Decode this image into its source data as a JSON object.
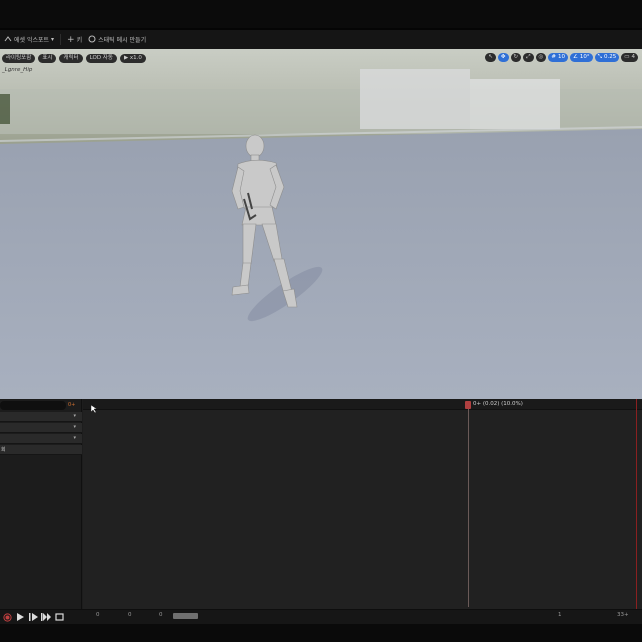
{
  "toolbar": {
    "export_label": "에셋 익스포트",
    "add_label": "키",
    "static_mesh_label": "스태틱 메시 만들기"
  },
  "viewport": {
    "pills": [
      "라이팅포함",
      "표시",
      "캐릭터",
      "LOD 자동",
      "x1.0"
    ],
    "asset_name": "_Lgnre_Hip",
    "right_controls": [
      "10",
      "10°",
      "0.25",
      "4"
    ]
  },
  "left_panel": {
    "plus_label": "0+",
    "tracks": [
      {
        "label": ""
      },
      {
        "label": ""
      },
      {
        "label": ""
      },
      {
        "label": "회"
      }
    ]
  },
  "timeline": {
    "playhead_label": "0+ (0.02) (10.0%)"
  },
  "bottombar": {
    "frame_start": "0",
    "frame_a": "0",
    "frame_b": "0",
    "frame_c": "1",
    "frame_end": "33+"
  },
  "colors": {
    "playhead": "#b04040",
    "accent_blue": "#2f6fd6",
    "end_marker": "#8a2020"
  }
}
